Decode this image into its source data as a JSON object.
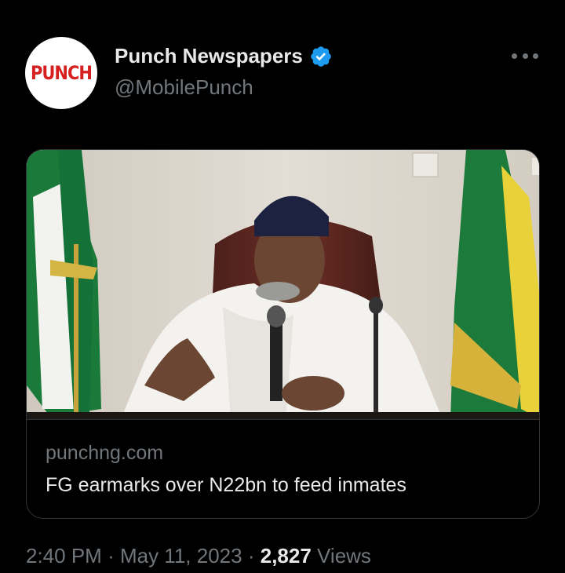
{
  "author": {
    "avatar_text": "PUNCH",
    "display_name": "Punch Newspapers",
    "handle": "@MobilePunch",
    "verified": true
  },
  "card": {
    "domain": "punchng.com",
    "title": "FG earmarks over N22bn to feed inmates"
  },
  "meta": {
    "time": "2:40 PM",
    "separator": "·",
    "date": "May 11, 2023",
    "views_count": "2,827",
    "views_label": "Views"
  },
  "colors": {
    "background": "#000000",
    "text_primary": "#e7e9ea",
    "text_secondary": "#71767b",
    "verified_blue": "#1d9bf0",
    "punch_red": "#d6201f"
  },
  "icons": {
    "verified": "verified-badge-icon",
    "more": "more-options-icon"
  }
}
